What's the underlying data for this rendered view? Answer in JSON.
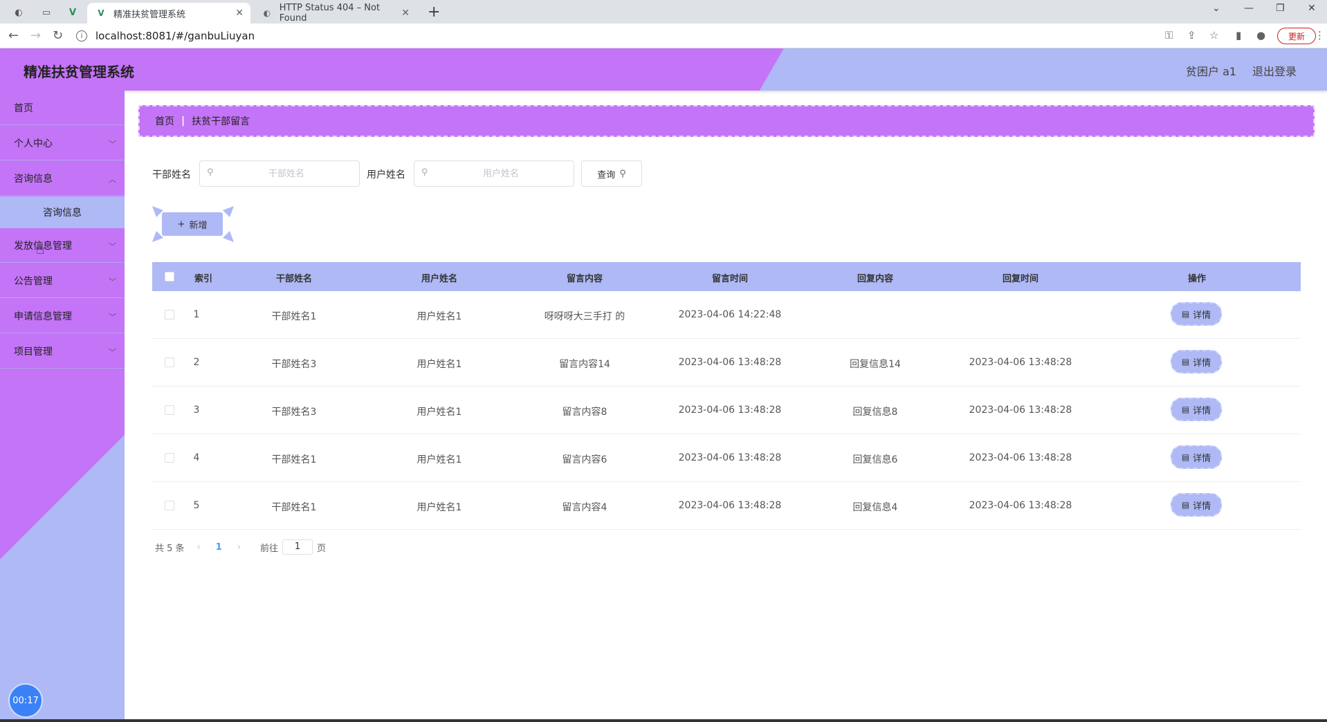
{
  "browser": {
    "tabs": [
      {
        "title": "精准扶贫管理系统",
        "active": true
      },
      {
        "title": "HTTP Status 404 – Not Found",
        "active": false
      }
    ],
    "url": "localhost:8081/#/ganbuLiuyan",
    "update_label": "更新"
  },
  "header": {
    "title": "精准扶贫管理系统",
    "user": "贫困户 a1",
    "logout": "退出登录"
  },
  "sidebar": {
    "items": [
      {
        "label": "首页"
      },
      {
        "label": "个人中心"
      },
      {
        "label": "咨询信息"
      },
      {
        "label": "发放信息管理"
      },
      {
        "label": "公告管理"
      },
      {
        "label": "申请信息管理"
      },
      {
        "label": "项目管理"
      }
    ],
    "subitem": "咨询信息",
    "timer": "00:17"
  },
  "breadcrumb": {
    "home": "首页",
    "current": "扶贫干部留言"
  },
  "search": {
    "cadre_label": "干部姓名",
    "cadre_placeholder": "干部姓名",
    "user_label": "用户姓名",
    "user_placeholder": "用户姓名",
    "query_label": "查询"
  },
  "toolbar": {
    "add_label": "新增"
  },
  "table": {
    "headers": [
      "索引",
      "干部姓名",
      "用户姓名",
      "留言内容",
      "留言时间",
      "回复内容",
      "回复时间",
      "操作"
    ],
    "rows": [
      {
        "index": "1",
        "cadre": "干部姓名1",
        "user": "用户姓名1",
        "content": "呀呀呀大三手打 的",
        "time": "2023-04-06 14:22:48",
        "reply": "",
        "reply_time": ""
      },
      {
        "index": "2",
        "cadre": "干部姓名3",
        "user": "用户姓名1",
        "content": "留言内容14",
        "time": "2023-04-06 13:48:28",
        "reply": "回复信息14",
        "reply_time": "2023-04-06 13:48:28"
      },
      {
        "index": "3",
        "cadre": "干部姓名3",
        "user": "用户姓名1",
        "content": "留言内容8",
        "time": "2023-04-06 13:48:28",
        "reply": "回复信息8",
        "reply_time": "2023-04-06 13:48:28"
      },
      {
        "index": "4",
        "cadre": "干部姓名1",
        "user": "用户姓名1",
        "content": "留言内容6",
        "time": "2023-04-06 13:48:28",
        "reply": "回复信息6",
        "reply_time": "2023-04-06 13:48:28"
      },
      {
        "index": "5",
        "cadre": "干部姓名1",
        "user": "用户姓名1",
        "content": "留言内容4",
        "time": "2023-04-06 13:48:28",
        "reply": "回复信息4",
        "reply_time": "2023-04-06 13:48:28"
      }
    ],
    "detail_label": "详情"
  },
  "pagination": {
    "total": "共 5 条",
    "current": "1",
    "goto_prefix": "前往",
    "goto_value": "1",
    "goto_suffix": "页"
  },
  "colors": {
    "purple": "#c474f7",
    "periwinkle": "#aeb9f5"
  }
}
